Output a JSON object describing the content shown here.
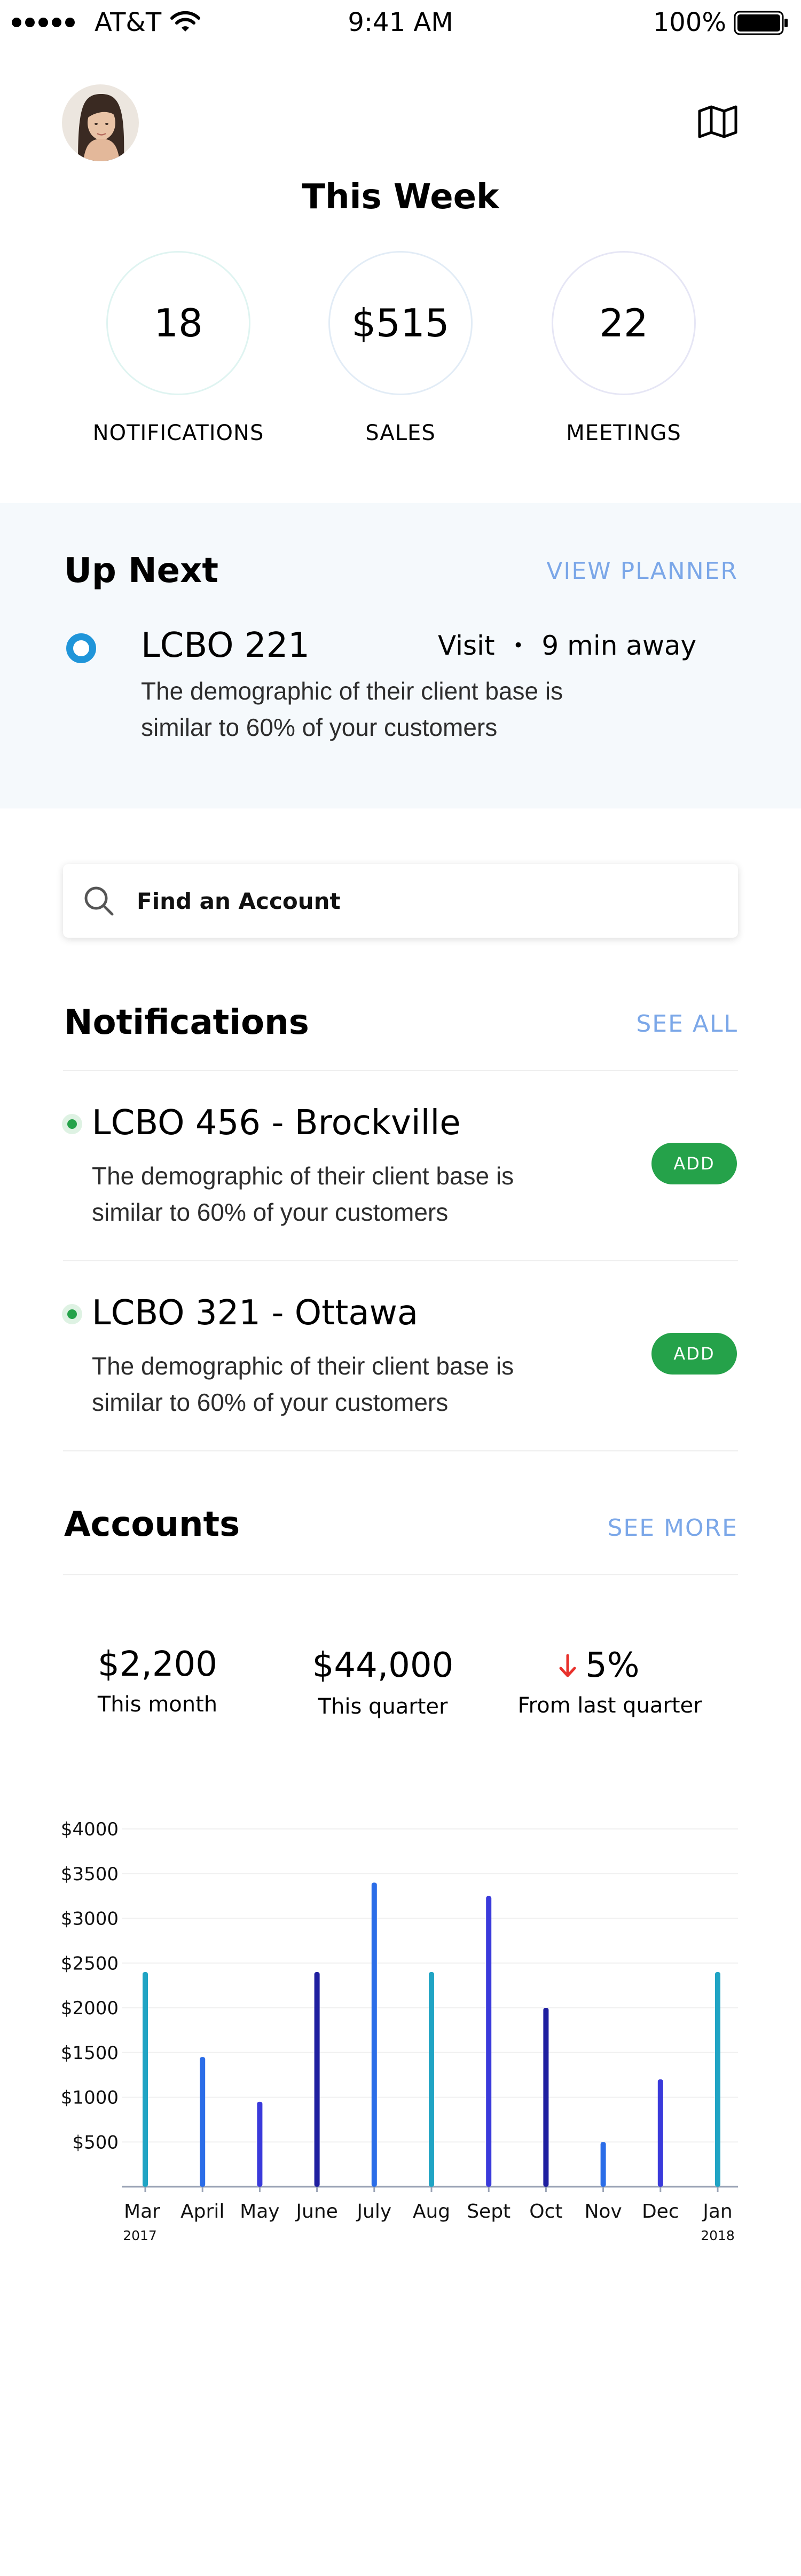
{
  "status_bar": {
    "carrier": "AT&T",
    "time": "9:41 AM",
    "battery": "100%"
  },
  "header": {
    "title": "This Week"
  },
  "stats": [
    {
      "value": "18",
      "label": "NOTIFICATIONS",
      "ring_color": "#dff4f1"
    },
    {
      "value": "$515",
      "label": "SALES",
      "ring_color": "#e2ecf6"
    },
    {
      "value": "22",
      "label": "MEETINGS",
      "ring_color": "#e6e6f5"
    }
  ],
  "up_next": {
    "title": "Up Next",
    "link": "VIEW PLANNER",
    "name": "LCBO 221",
    "type": "Visit",
    "separator": "•",
    "distance": "9 min away",
    "line1": "The demographic of their client base is",
    "line2": "similar to 60% of your customers"
  },
  "search": {
    "placeholder": "Find an Account"
  },
  "notifications": {
    "title": "Notifications",
    "link": "SEE ALL",
    "items": [
      {
        "title": "LCBO 456 - Brockville",
        "line1": "The demographic of their client base is",
        "line2": "similar to 60% of your customers",
        "action": "ADD"
      },
      {
        "title": "LCBO 321 - Ottawa",
        "line1": "The demographic of their client base is",
        "line2": "similar to 60% of your customers",
        "action": "ADD"
      }
    ]
  },
  "accounts": {
    "title": "Accounts",
    "link": "SEE MORE",
    "kpis": [
      {
        "value": "$2,200",
        "label": "This month"
      },
      {
        "value": "$44,000",
        "label": "This quarter"
      },
      {
        "value": "5%",
        "label": "From last quarter",
        "trend": "down"
      }
    ]
  },
  "colors": {
    "accent": "#7ba7e8",
    "green": "#25a24a",
    "down_arrow": "#e8312c",
    "teal": "#20a4c4",
    "blue": "#2b6de8",
    "indigo": "#3a3adb",
    "navy": "#1f1fa0"
  },
  "chart_data": {
    "type": "bar",
    "categories": [
      "Mar",
      "April",
      "May",
      "June",
      "July",
      "Aug",
      "Sept",
      "Oct",
      "Nov",
      "Dec",
      "Jan"
    ],
    "year_labels": {
      "Mar": "2017",
      "Jan": "2018"
    },
    "values": [
      2400,
      1450,
      950,
      2400,
      3400,
      2400,
      3250,
      2000,
      500,
      1200,
      2400
    ],
    "bar_colors": [
      "#20a4c4",
      "#2b6de8",
      "#3a3adb",
      "#1f1fa0",
      "#2b6de8",
      "#20a4c4",
      "#3a3adb",
      "#1f1fa0",
      "#2b6de8",
      "#3a3adb",
      "#20a4c4"
    ],
    "y_ticks": [
      "$500",
      "$1000",
      "$1500",
      "$2000",
      "$2500",
      "$3000",
      "$3500",
      "$4000"
    ],
    "ylim": [
      0,
      4000
    ],
    "grid": true
  }
}
